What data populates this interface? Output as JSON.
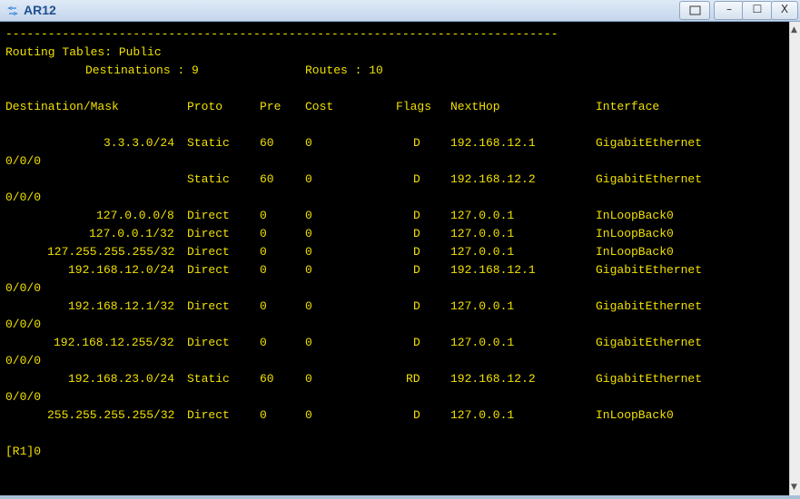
{
  "window": {
    "title": "AR12",
    "icon": "router-app-icon",
    "minimize_label": "–",
    "maximize_label": "☐",
    "close_label": "X"
  },
  "terminal": {
    "separator": "------------------------------------------------------------------------------",
    "heading": "Routing Tables: Public",
    "destinations_label": "Destinations : 9",
    "routes_label": "Routes : 10",
    "columns": [
      "Destination/Mask",
      "Proto",
      "Pre",
      "Cost",
      "Flags",
      "NextHop",
      "Interface"
    ],
    "rows": [
      {
        "dest": "3.3.3.0/24",
        "proto": "Static",
        "pre": "60",
        "cost": "0",
        "flags": "D",
        "nexthop": "192.168.12.1",
        "iface": "GigabitEthernet",
        "cont": "0/0/0"
      },
      {
        "dest": "",
        "proto": "Static",
        "pre": "60",
        "cost": "0",
        "flags": "D",
        "nexthop": "192.168.12.2",
        "iface": "GigabitEthernet",
        "cont": "0/0/0"
      },
      {
        "dest": "127.0.0.0/8",
        "proto": "Direct",
        "pre": "0",
        "cost": "0",
        "flags": "D",
        "nexthop": "127.0.0.1",
        "iface": "InLoopBack0",
        "cont": ""
      },
      {
        "dest": "127.0.0.1/32",
        "proto": "Direct",
        "pre": "0",
        "cost": "0",
        "flags": "D",
        "nexthop": "127.0.0.1",
        "iface": "InLoopBack0",
        "cont": ""
      },
      {
        "dest": "127.255.255.255/32",
        "proto": "Direct",
        "pre": "0",
        "cost": "0",
        "flags": "D",
        "nexthop": "127.0.0.1",
        "iface": "InLoopBack0",
        "cont": ""
      },
      {
        "dest": "192.168.12.0/24",
        "proto": "Direct",
        "pre": "0",
        "cost": "0",
        "flags": "D",
        "nexthop": "192.168.12.1",
        "iface": "GigabitEthernet",
        "cont": "0/0/0"
      },
      {
        "dest": "192.168.12.1/32",
        "proto": "Direct",
        "pre": "0",
        "cost": "0",
        "flags": "D",
        "nexthop": "127.0.0.1",
        "iface": "GigabitEthernet",
        "cont": "0/0/0"
      },
      {
        "dest": "192.168.12.255/32",
        "proto": "Direct",
        "pre": "0",
        "cost": "0",
        "flags": "D",
        "nexthop": "127.0.0.1",
        "iface": "GigabitEthernet",
        "cont": "0/0/0"
      },
      {
        "dest": "192.168.23.0/24",
        "proto": "Static",
        "pre": "60",
        "cost": "0",
        "flags": "RD",
        "nexthop": "192.168.12.2",
        "iface": "GigabitEthernet",
        "cont": "0/0/0"
      },
      {
        "dest": "255.255.255.255/32",
        "proto": "Direct",
        "pre": "0",
        "cost": "0",
        "flags": "D",
        "nexthop": "127.0.0.1",
        "iface": "InLoopBack0",
        "cont": ""
      }
    ],
    "prompt": "[R1]0"
  },
  "colors": {
    "terminal_bg": "#000000",
    "terminal_text": "#f0e000",
    "title_text": "#1f4f8f"
  }
}
